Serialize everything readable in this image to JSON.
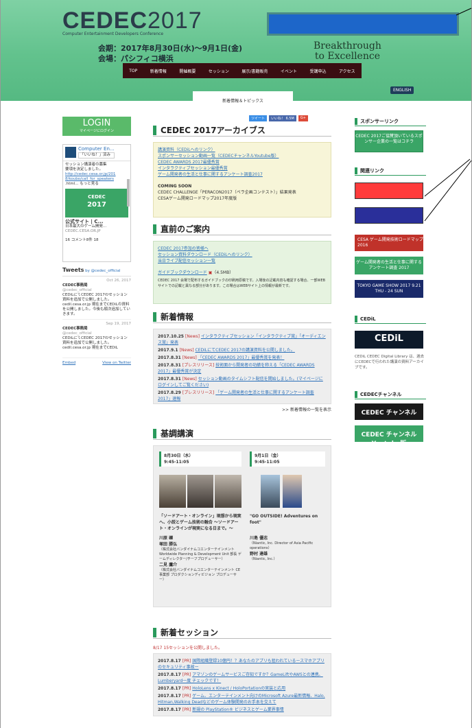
{
  "header": {
    "logo_main": "CEDEC",
    "logo_year": "2017",
    "logo_sub": "Computer Entertainment Developers Conference",
    "date_line": "会期：2017年8月30日(水)～9月1日(金)",
    "venue_line": "会場：パシフィコ横浜",
    "tagline1": "Breakthrough",
    "tagline2": "to Excellence",
    "english_btn": "ENGLISH",
    "tab": "新着情報＆トピックス"
  },
  "nav": [
    "TOP",
    "新着情報",
    "開催概要",
    "セッション",
    "展示/書籍販売",
    "イベント",
    "受講申込",
    "アクセス"
  ],
  "left": {
    "login_label": "LOGIN",
    "login_sub": "マイページにログイン",
    "fb_title": "Computer En...",
    "fb_like": "「いいね！」済み",
    "fb_text1": "セッション講演者の募集",
    "fb_text2": "要項を決定しました。",
    "fb_url1": "http://cedec.cesa.or.jp/201",
    "fb_url2": "8/koubo/call_for_speakers",
    "fb_more": ".html... もっと見る",
    "fb_site": "公式サイト | C...",
    "fb_desc": "日本最大のゲーム開発...",
    "fb_domain": "CEDEC.CESA.OR.JP",
    "fb_stats": "16 コメント8件 18",
    "tweets_title": "Tweets",
    "tweets_by": "by @cedec_official",
    "tw1_date": "Oct 26, 2017",
    "tw1_name": "CEDEC事務局",
    "tw1_handle": "@cedec_official",
    "tw1_text": "CEDiLにてCEDEC 2017のセッション資料を追加で公開しました。cedil.cesa.or.jp 現在までCEDiLの資料を公開しました。今後も順次追加していきます。",
    "tw2_date": "Sep 19, 2017",
    "tw2_name": "CEDEC事務局",
    "tw2_handle": "@cedec_official",
    "tw2_text": "CEDiLにてCEDEC 2017のセッション資料を追加で公開しました。cedil.cesa.or.jp 現在までCEDiL",
    "embed": "Embed",
    "view_twitter": "View on Twitter"
  },
  "social": {
    "tweet": "ツイート",
    "like": "いいね！ 6.5M",
    "gplus": "G+"
  },
  "archive": {
    "title": "CEDEC 2017アーカイブス",
    "links": [
      "講演資料（CEDiLへのリンク）",
      "スポンサーセッション動画一覧（CEDECチャンネルYoutube版）",
      "CEDEC AWARDS 2017最優秀賞",
      "インタラクティブセッション最優秀賞",
      "ゲーム開発者の生活と仕事に関するアンケート調査2017"
    ],
    "coming": "COMING SOON",
    "coming_items": [
      "CEDEC CHALLENGE「PERACON2017（ペラ企画コンテスト）」結果発表",
      "CESAゲーム開発ロードマップ2017年度版"
    ]
  },
  "guide": {
    "title": "直前のご案内",
    "links": [
      "CEDEC 2017参加の皆様へ",
      "セッション資料ダウンロード（CEDiLへのリンク）",
      "当日ライブ配信セッション一覧"
    ],
    "book": "ガイドブックダウンロード",
    "book_size": "（4.5MB）",
    "note": "CEDEC 2017 会場で配布するガイドブックの印刷用原稿です。入場後の記載内容も確認する場合、一部WEBサイトでの記載と異なる部分があります。この場合はWEBサイト上の情報が最新です。"
  },
  "news": {
    "title": "新着情報",
    "items": [
      {
        "date": "2017.10.25",
        "tag": "[News]",
        "text": "インタラクティブセッション「インタラクティブ賞」「オーディエンス賞」発表"
      },
      {
        "date": "2017.9.1",
        "tag": "[News]",
        "text": "CEDiLにてCEDEC 2017の講演資料を公開しました。"
      },
      {
        "date": "2017.8.31",
        "tag": "[News]",
        "text": "「CEDEC AWARDS 2017」最優秀賞を発表！"
      },
      {
        "date": "2017.8.31",
        "tag": "[プレスリリース]",
        "text": "技術面から開発者の功績を称える「CEDEC AWARDS 2017」最優秀賞が決定"
      },
      {
        "date": "2017.8.31",
        "tag": "[News]",
        "text": "セッション動画のタイムシフト配信を開始しました。(マイページにログインしてご覧ください)"
      },
      {
        "date": "2017.8.29",
        "tag": "[プレスリリース]",
        "text": "「ゲーム開発者の生活と仕事に関するアンケート調査2017」速報"
      }
    ],
    "more": ">> 新着情報の一覧を表示"
  },
  "keynote": {
    "title": "基調講演",
    "day1": "8月30日（水）",
    "time1": "9:45-11:05",
    "day2": "9月1日（金）",
    "time2": "9:45-11:05",
    "talk1": "「ソードアート・オンライン」現想から現実へ、小説とゲーム技術の融合 ～ソードアート・オンラインが現実になる日まで。～",
    "talk2": "\"GO OUTSIDE! Adventures on foot\"",
    "sp1a": "川原 礫",
    "sp1b": "塚田 勝弘",
    "sp1b_org": "（株式会社バンダイナムコエンターテインメント Worldwide Planning & Development Unit 部長 ゲームディレクター/チーフプロデューサー）",
    "sp1c": "二見 鷹介",
    "sp1c_org": "（株式会社バンダイナムコエンターテインメント CE事業部 プロダクションディビジョン プロデューサー）",
    "sp2a": "川島 優志",
    "sp2a_org": "（Niantic, Inc. Director of Asia Pacific operations）",
    "sp2b": "野村 達雄",
    "sp2b_org": "（Niantic, Inc.）"
  },
  "sessions": {
    "title": "新着セッション",
    "notice": "8/17 15セッションを公開しました。",
    "items": [
      {
        "date": "2017.8.17",
        "tag": "[PR]",
        "text": "国際組織登録10億円！？あなたのアプリも狙われているースマホアプリのセキュリティ事故ー"
      },
      {
        "date": "2017.8.17",
        "tag": "[PR]",
        "text": "アマゾンのゲームサービスご存知ですか？GameLiftやAWSとの連携、Lumberyard一度 チェックです！"
      },
      {
        "date": "2017.8.17",
        "tag": "[PR]",
        "text": "HoloLens x Kinect / HoloPortationの実装と応用"
      },
      {
        "date": "2017.8.17",
        "tag": "[PR]",
        "text": "ゲーム、エンターテインメント向けのMicrosoft Azure最新情報、Halo, Hitman,Walking Deadなどのゲーム体験開発のお手本を交えて"
      },
      {
        "date": "2017.8.17",
        "tag": "[PR]",
        "text": "新規の PlayStation® ビジネスとゲーム業界事情"
      }
    ]
  },
  "right": {
    "sponsor_title": "スポンサーリンク",
    "sponsor_banner": "CEDEC 2017ご協賛頂いているスポンサー企業の一覧はコチラ",
    "related_title": "関連リンク",
    "cesa_banner": "CESA ゲーム開発技術ロードマップ2016",
    "survey_banner": "ゲーム開発者の生活と仕事に関するアンケート調査 2017",
    "tgs_banner": "TOKYO GAME SHOW 2017 9.21 THU - 24 SUN",
    "cedil_title": "CEDiL",
    "cedil_logo": "CEDiL",
    "cedil_text": "CEDiL CEDEC Digital Library は、過去にCEDECで行われた講演の資料アーカイブです。",
    "channel_title": "CEDECチャンネル",
    "channel1": "CEDEC チャンネル",
    "channel2": "CEDEC チャンネル Youtube版"
  },
  "colors": {
    "header_green": "#62c28d",
    "nav_bg": "#3a0e12",
    "accent_green": "#2a9a5c",
    "redact_blue": "#1d66c9",
    "redact_red": "#ff3b3b",
    "redact_navy": "#2a2f9a"
  }
}
